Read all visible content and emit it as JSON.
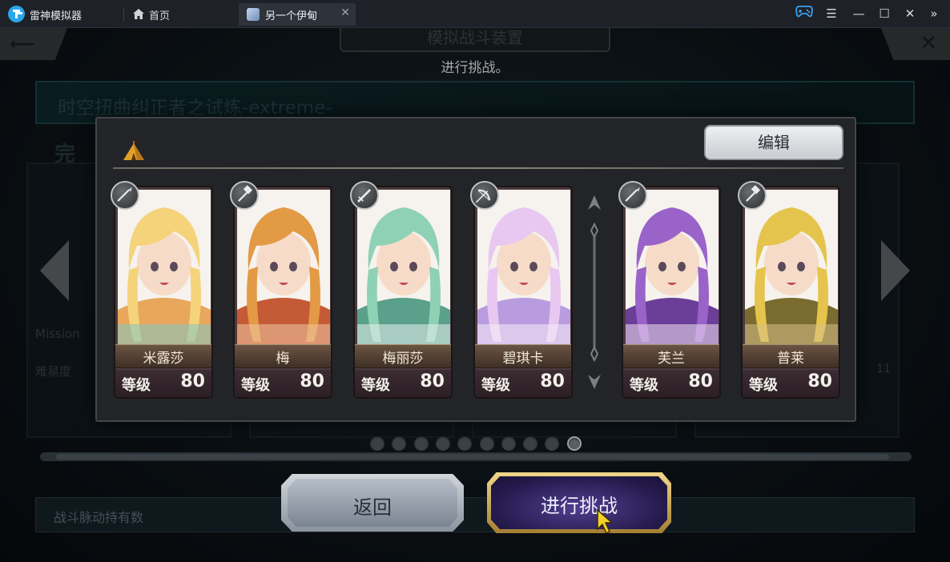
{
  "titlebar": {
    "app_name": "雷神模拟器",
    "home_tab": "首页",
    "active_tab": "另一个伊甸",
    "tab_close": "✕",
    "controls": {
      "gamepad": "gamepad-icon",
      "menu": "☰",
      "minimize": "—",
      "maximize": "☐",
      "close": "✕",
      "expand": "»"
    }
  },
  "background": {
    "header_title": "模拟战斗装置",
    "prompt": "进行挑战。",
    "stage_name": "时空扭曲纠正者之试炼-extreme-",
    "complete": "完",
    "mission_label": "Mission",
    "difficulty_label": "难易度",
    "difficulty_value": "11",
    "currency_label": "战斗脉动持有数",
    "back_symbol": "⟵",
    "close_symbol": "✕"
  },
  "dialog": {
    "edit_label": "编辑",
    "party_icon": "tent-icon"
  },
  "party": [
    {
      "name": "米露莎",
      "level_label": "等级",
      "level": "80",
      "weapon": "spear-icon",
      "palette": [
        "#f4d37a",
        "#e8a75c",
        "#7ec6c5"
      ]
    },
    {
      "name": "梅",
      "level_label": "等级",
      "level": "80",
      "weapon": "hammer-icon",
      "palette": [
        "#e39a45",
        "#c55a36",
        "#f1c8a4"
      ]
    },
    {
      "name": "梅丽莎",
      "level_label": "等级",
      "level": "80",
      "weapon": "sword-icon",
      "palette": [
        "#8ed1b4",
        "#5aa08a",
        "#e9f0ee"
      ]
    },
    {
      "name": "碧琪卡",
      "level_label": "等级",
      "level": "80",
      "weapon": "bow-icon",
      "palette": [
        "#e8c8f0",
        "#b99ce0",
        "#f6eef8"
      ]
    },
    {
      "name": "芙兰",
      "level_label": "等级",
      "level": "80",
      "weapon": "spear-icon",
      "palette": [
        "#9a63c9",
        "#6b3f98",
        "#f0e4f0"
      ]
    },
    {
      "name": "普莱",
      "level_label": "等级",
      "level": "80",
      "weapon": "hammer-icon",
      "palette": [
        "#e4c44c",
        "#7a6b2e",
        "#d9c18c"
      ]
    }
  ],
  "pagination": {
    "total": 10,
    "active_index": 9
  },
  "buttons": {
    "back_label": "返回",
    "challenge_label": "进行挑战"
  },
  "colors": {
    "accent_gold": "#f1d68b",
    "challenge_purple": "#4e3f8e",
    "titlebar_bg": "#1e2128"
  }
}
